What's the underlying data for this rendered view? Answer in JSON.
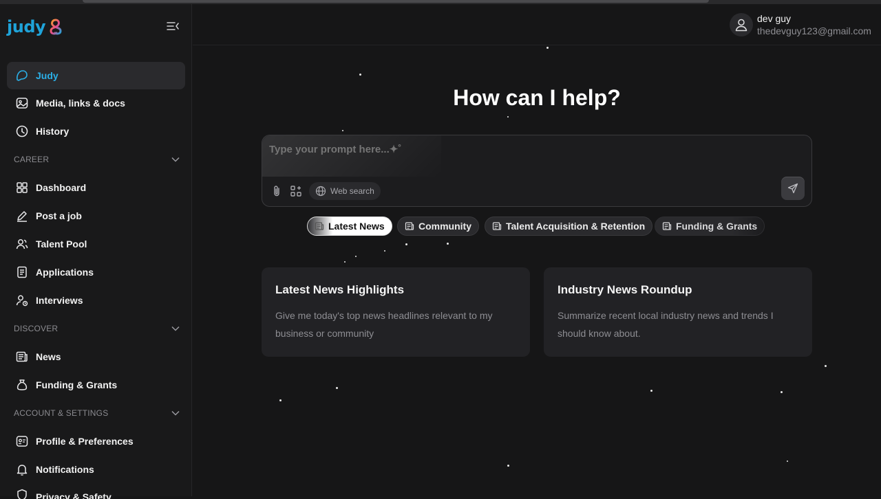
{
  "logo": {
    "text": "judy"
  },
  "sidebar": {
    "items": [
      {
        "label": "Judy",
        "icon": "chat-icon"
      },
      {
        "label": "Media, links & docs",
        "icon": "image-icon"
      },
      {
        "label": "History",
        "icon": "clock-icon"
      },
      {
        "label": "Dashboard",
        "icon": "grid-icon"
      },
      {
        "label": "Post a job",
        "icon": "pencil-icon"
      },
      {
        "label": "Talent Pool",
        "icon": "users-icon"
      },
      {
        "label": "Applications",
        "icon": "document-icon"
      },
      {
        "label": "Interviews",
        "icon": "user-clock-icon"
      },
      {
        "label": "News",
        "icon": "newspaper-icon"
      },
      {
        "label": "Funding & Grants",
        "icon": "money-bag-icon"
      },
      {
        "label": "Profile & Preferences",
        "icon": "profile-card-icon"
      },
      {
        "label": "Notifications",
        "icon": "bell-icon"
      },
      {
        "label": "Privacy & Safety",
        "icon": "shield-icon"
      }
    ],
    "sections": [
      {
        "label": "CAREER"
      },
      {
        "label": "DISCOVER"
      },
      {
        "label": "ACCOUNT & SETTINGS"
      }
    ]
  },
  "user": {
    "name": "dev guy",
    "email": "thedevguy123@gmail.com"
  },
  "main": {
    "title": "How can I help?",
    "prompt": {
      "placeholder": "Type your prompt here...✦˚",
      "value": ""
    },
    "web_search_label": "Web search",
    "chips": [
      {
        "label": "Latest News"
      },
      {
        "label": "Community"
      },
      {
        "label": "Talent Acquisition & Retention"
      },
      {
        "label": "Funding & Grants"
      }
    ],
    "cards": [
      {
        "title": "Latest News Highlights",
        "desc": "Give me today's top news headlines relevant to my business or community"
      },
      {
        "title": "Industry News Roundup",
        "desc": "Summarize recent local industry news and trends I should know about."
      }
    ]
  },
  "colors": {
    "accent": "#2bb0e8",
    "background": "#161617",
    "sidebar": "#19191a",
    "card": "#222225"
  }
}
